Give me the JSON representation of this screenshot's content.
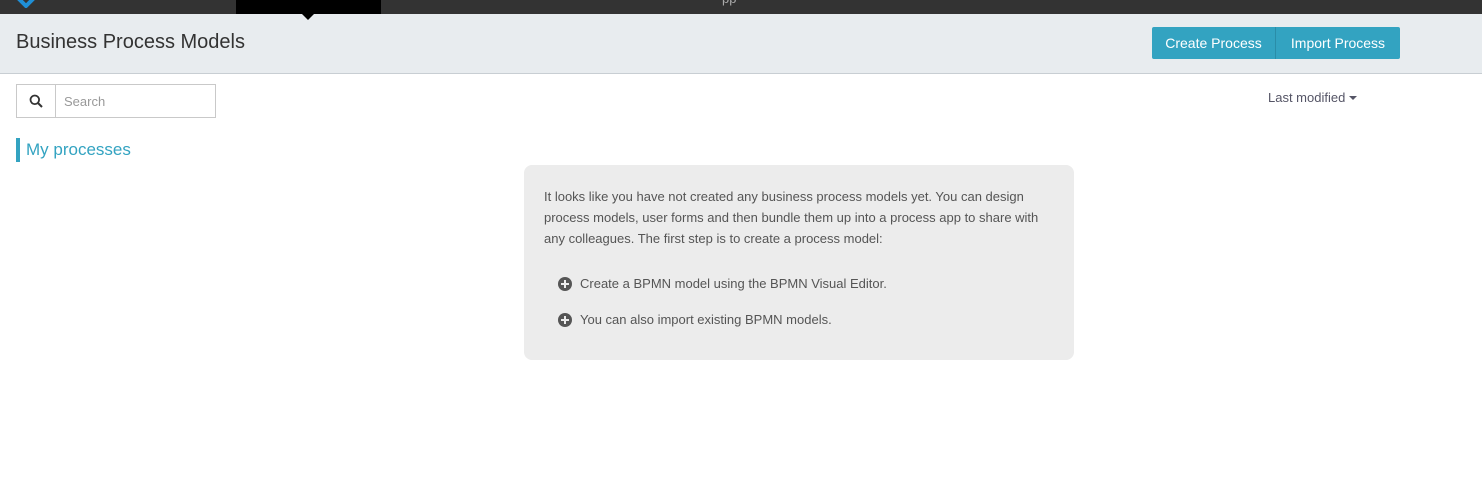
{
  "topbar": {
    "nav_fragment": "pp"
  },
  "header": {
    "title": "Business Process Models",
    "create_label": "Create Process",
    "import_label": "Import Process"
  },
  "search": {
    "placeholder": "Search",
    "value": ""
  },
  "sort": {
    "label": "Last modified"
  },
  "filters": {
    "my_processes": "My processes"
  },
  "empty_state": {
    "intro": "It looks like you have not created any business process models yet. You can design process models, user forms and then bundle them up into a process app to share with any colleagues. The first step is to create a process model:",
    "items": [
      "Create a BPMN model using the BPMN Visual Editor.",
      "You can also import existing BPMN models."
    ]
  },
  "colors": {
    "accent": "#33a3c1",
    "topbar": "#333333",
    "header_bg": "#e8ecef",
    "panel_bg": "#ececec"
  },
  "icons": [
    "logo-icon",
    "search-icon",
    "caret-down-icon",
    "plus-circle-icon"
  ]
}
